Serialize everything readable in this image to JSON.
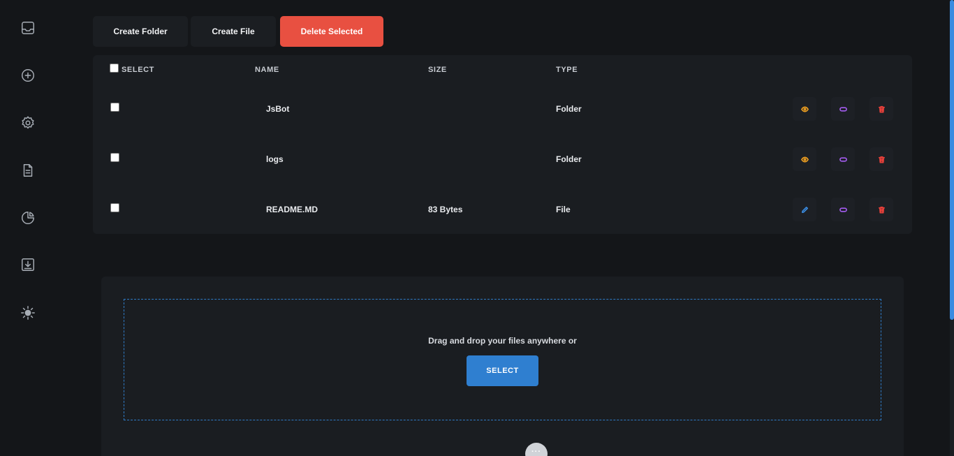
{
  "sidebar": {
    "items": [
      {
        "icon": "inbox-icon"
      },
      {
        "icon": "add-circle-icon"
      },
      {
        "icon": "gear-icon"
      },
      {
        "icon": "document-icon"
      },
      {
        "icon": "pie-chart-icon"
      },
      {
        "icon": "download-icon"
      },
      {
        "icon": "sun-icon"
      }
    ]
  },
  "toolbar": {
    "create_folder": "Create Folder",
    "create_file": "Create File",
    "delete_selected": "Delete Selected"
  },
  "table": {
    "headers": {
      "select": "SELECT",
      "name": "NAME",
      "size": "SIZE",
      "type": "TYPE"
    },
    "rows": [
      {
        "name": "JsBot",
        "size": "",
        "type": "Folder",
        "primary_action": "view"
      },
      {
        "name": "logs",
        "size": "",
        "type": "Folder",
        "primary_action": "view"
      },
      {
        "name": "README.MD",
        "size": "83 Bytes",
        "type": "File",
        "primary_action": "edit"
      }
    ]
  },
  "upload": {
    "text": "Drag and drop your files anywhere or",
    "select_label": "SELECT",
    "more_label": "···"
  },
  "colors": {
    "background": "#141619",
    "card": "#1a1d21",
    "danger": "#e85041",
    "primary": "#2f7fd0",
    "view_icon": "#f0a020",
    "rename_icon": "#a45cf0",
    "delete_icon": "#e8403a",
    "edit_icon": "#3a8be0"
  }
}
